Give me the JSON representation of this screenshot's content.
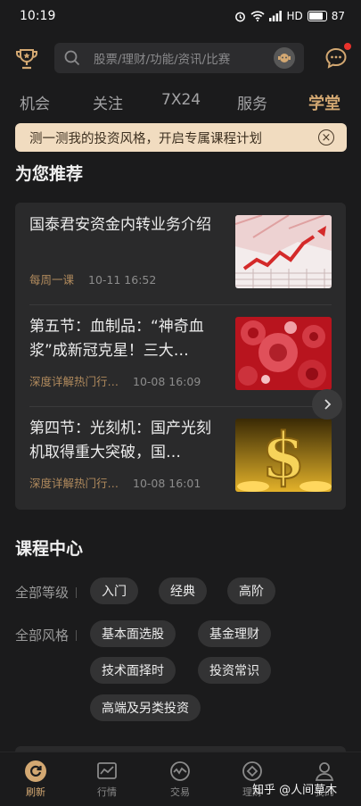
{
  "status_bar": {
    "time": "10:19",
    "network": "HD",
    "battery": "87",
    "battery_level": 0.87
  },
  "search": {
    "placeholder": "股票/理财/功能/资讯/比赛"
  },
  "tabs": [
    {
      "label": "机会",
      "active": false
    },
    {
      "label": "关注",
      "active": false
    },
    {
      "label": "7X24",
      "active": false
    },
    {
      "label": "服务",
      "active": false
    },
    {
      "label": "学堂",
      "active": true
    }
  ],
  "banner": {
    "text": "测一测我的投资风格，开启专属课程计划"
  },
  "recommend": {
    "title": "为您推荐",
    "articles": [
      {
        "title": "国泰君安资金内转业务介绍",
        "category": "每周一课",
        "time": "10-11 16:52",
        "thumb": "chart-arrow-image"
      },
      {
        "title": "第五节：血制品：“神奇血浆”成新冠克星！三大…",
        "category": "深度详解热门行…",
        "time": "10-08 16:09",
        "thumb": "blood-cells-image"
      },
      {
        "title": "第四节：光刻机：国产光刻机取得重大突破，国…",
        "category": "深度详解热门行…",
        "time": "10-08 16:01",
        "thumb": "dollar-sign-image"
      }
    ]
  },
  "courses": {
    "title": "课程中心",
    "level_label": "全部等级",
    "levels": [
      "入门",
      "经典",
      "高阶"
    ],
    "style_label": "全部风格",
    "styles": [
      "基本面选股",
      "基金理财",
      "技术面择时",
      "投资常识",
      "高端及另类投资"
    ]
  },
  "bottom_nav": [
    {
      "label": "刷新",
      "icon": "refresh-icon",
      "active": true
    },
    {
      "label": "行情",
      "icon": "market-chart-icon",
      "active": false
    },
    {
      "label": "交易",
      "icon": "trade-icon",
      "active": false
    },
    {
      "label": "理财",
      "icon": "wealth-icon",
      "active": false
    },
    {
      "label": "我的",
      "icon": "user-icon",
      "active": false
    }
  ],
  "watermark": "知乎 @人间草木",
  "colors": {
    "accent": "#d3a872",
    "background": "#1b1b1c",
    "card": "#2a2a2b",
    "banner": "#f1dcc0",
    "notification": "#e8322c"
  }
}
